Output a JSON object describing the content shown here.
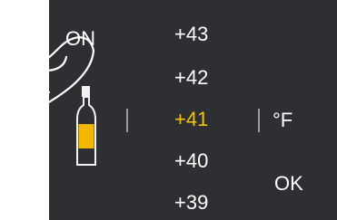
{
  "power": {
    "label": "ON"
  },
  "temperatures": [
    "+43",
    "+42",
    "+41",
    "+40",
    "+39"
  ],
  "selected_index": 2,
  "unit": {
    "label": "°F"
  },
  "confirm": {
    "label": "OK"
  },
  "colors": {
    "panel": "#2d2f32",
    "text": "#ffffff",
    "selected": "#f2c500",
    "wine_fill": "#f2b800"
  },
  "icons": {
    "bottle": "wine-bottle-icon",
    "hand": "pointing-hand-icon"
  }
}
